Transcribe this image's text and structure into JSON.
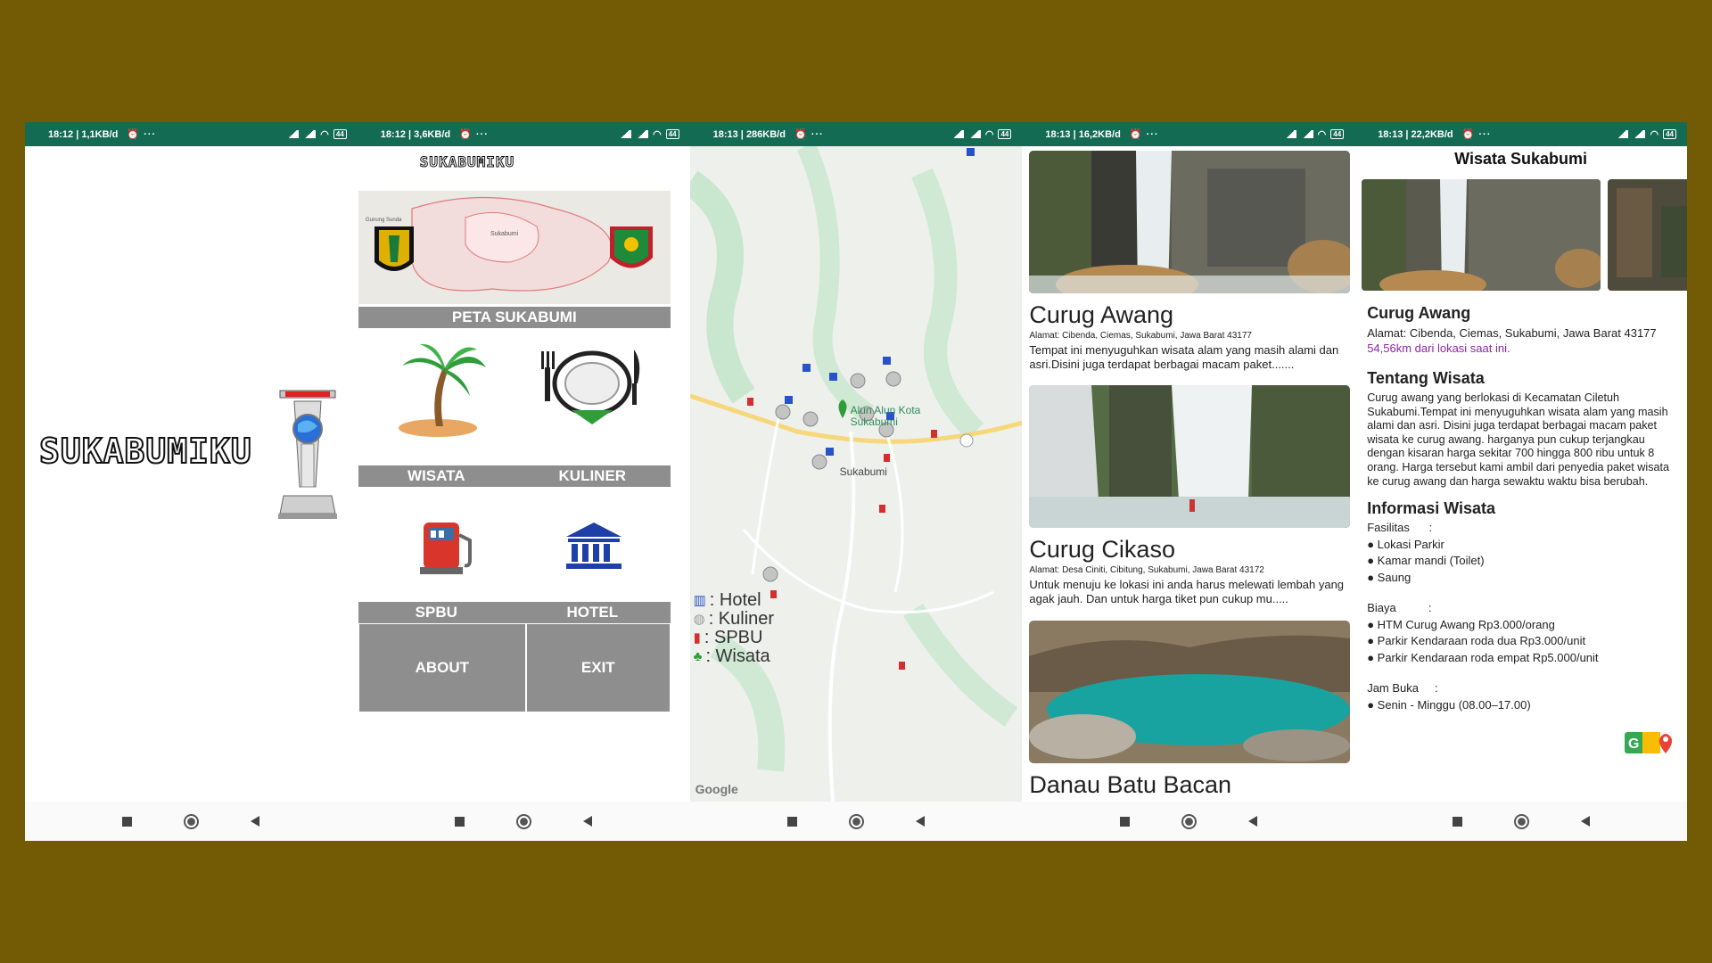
{
  "screens": [
    {
      "status": {
        "time": "18:12",
        "speed": "1,1KB/d",
        "battery": "44"
      }
    },
    {
      "status": {
        "time": "18:12",
        "speed": "3,6KB/d",
        "battery": "44"
      }
    },
    {
      "status": {
        "time": "18:13",
        "speed": "286KB/d",
        "battery": "44"
      }
    },
    {
      "status": {
        "time": "18:13",
        "speed": "16,2KB/d",
        "battery": "44"
      }
    },
    {
      "status": {
        "time": "18:13",
        "speed": "22,2KB/d",
        "battery": "44"
      }
    }
  ],
  "splash": {
    "logo_text": "SUKABUMIKU"
  },
  "menu": {
    "app_title": "SUKABUMIKU",
    "map_label": "PETA SUKABUMI",
    "map_place_1": "Sukabumi",
    "map_place_2": "Gunung Sunda",
    "wisata": "WISATA",
    "kuliner": "KULINER",
    "spbu": "SPBU",
    "hotel": "HOTEL",
    "about": "ABOUT",
    "exit": "EXIT"
  },
  "map": {
    "city_label": "Sukabumi",
    "alun_label": "Alun Alun Kota Sukabumi",
    "legend": [
      ": Hotel",
      ": Kuliner",
      ": SPBU",
      ": Wisata"
    ],
    "google": "Google"
  },
  "list": [
    {
      "title": "Curug Awang",
      "address": "Alamat: Cibenda, Ciemas, Sukabumi, Jawa Barat 43177",
      "desc": "Tempat ini menyuguhkan wisata alam yang masih alami dan asri.Disini juga terdapat berbagai macam paket......."
    },
    {
      "title": "Curug Cikaso",
      "address": "Alamat: Desa Ciniti, Cibitung, Sukabumi, Jawa Barat 43172",
      "desc": "Untuk menuju ke lokasi ini anda harus melewati lembah yang agak jauh. Dan untuk harga tiket pun cukup mu....."
    },
    {
      "title": "Danau Batu Bacan",
      "address": "",
      "desc": ""
    }
  ],
  "detail": {
    "header": "Wisata Sukabumi",
    "title": "Curug Awang",
    "address": "Alamat: Cibenda, Ciemas, Sukabumi, Jawa Barat 43177",
    "distance": "54,56km dari lokasi saat ini.",
    "about_heading": "Tentang Wisata",
    "about_text": "Curug awang yang berlokasi di Kecamatan Ciletuh Sukabumi.Tempat ini menyuguhkan wisata alam yang masih alami dan asri. Disini juga terdapat berbagai macam paket wisata ke curug awang. harganya pun cukup terjangkau dengan kisaran harga sekitar 700 hingga 800 ribu untuk 8 orang. Harga tersebut kami ambil dari penyedia paket wisata ke curug awang dan harga sewaktu waktu bisa berubah.",
    "info_heading": "Informasi Wisata",
    "fasilitas_label": "Fasilitas      :",
    "fasilitas": [
      "● Lokasi Parkir",
      "● Kamar mandi (Toilet)",
      "● Saung"
    ],
    "biaya_label": "Biaya          :",
    "biaya": [
      "● HTM Curug Awang Rp3.000/orang",
      "● Parkir Kendaraan roda dua Rp3.000/unit",
      "● Parkir Kendaraan roda empat Rp5.000/unit"
    ],
    "jam_label": "Jam Buka     :",
    "jam": [
      "● Senin - Minggu (08.00–17.00)"
    ]
  }
}
